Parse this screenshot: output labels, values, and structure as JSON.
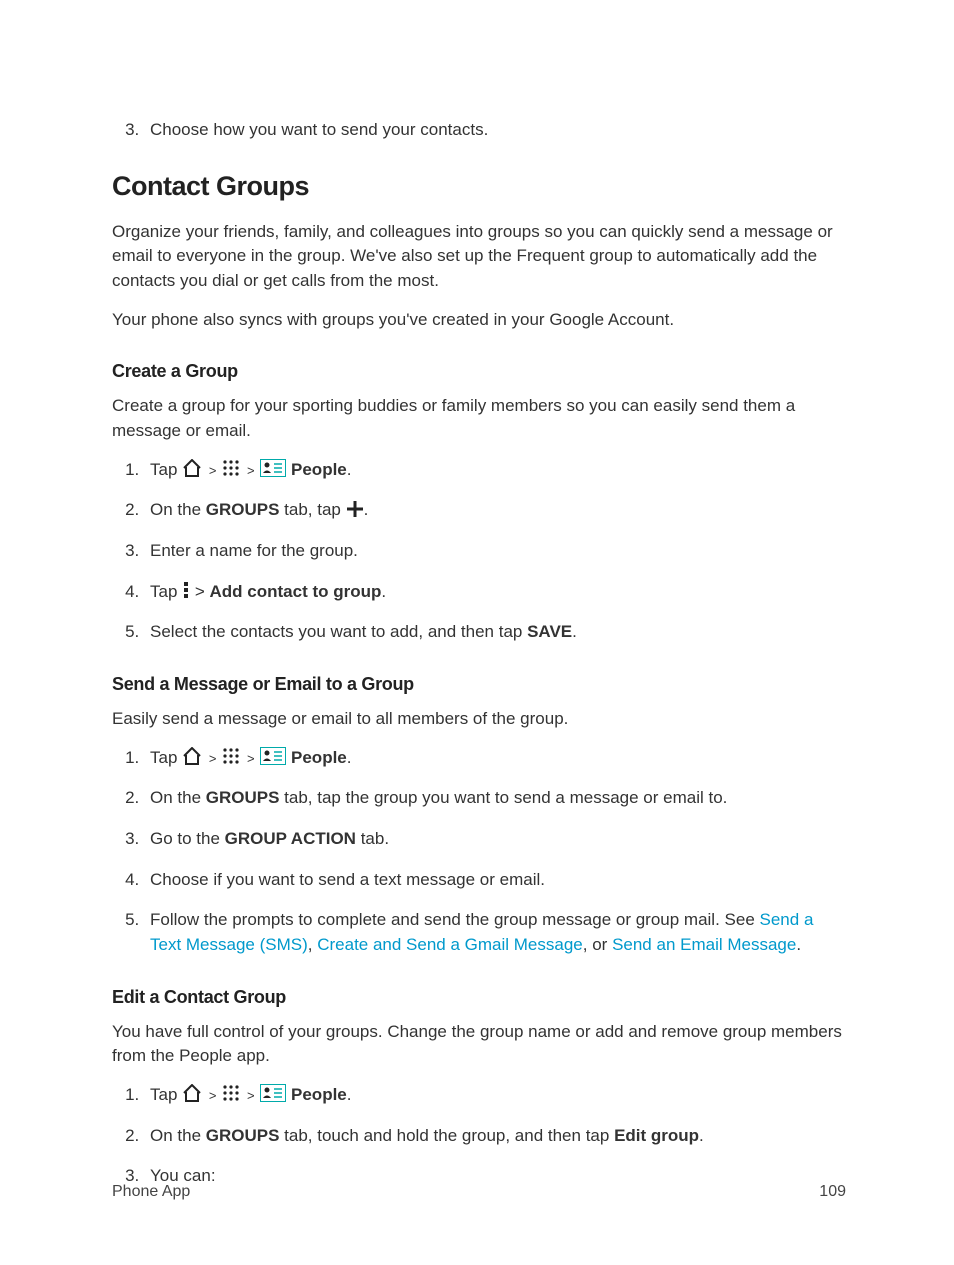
{
  "topList": {
    "start": 3,
    "item1": "Choose how you want to send your contacts."
  },
  "section": {
    "title": "Contact Groups",
    "intro1": "Organize your friends, family, and colleagues into groups so you can quickly send a message or email to everyone in the group. We've also set up the Frequent group to automatically add the contacts you dial or get calls from the most.",
    "intro2": "Your phone also syncs with groups you've created in your Google Account."
  },
  "createGroup": {
    "heading": "Create a Group",
    "intro": "Create a group for your sporting buddies or family members so you can easily send them a message or email.",
    "tap": "Tap",
    "peopleBold": "People",
    "step2a": "On the ",
    "step2b": "GROUPS",
    "step2c": " tab, tap ",
    "step2d": ".",
    "step3": "Enter a name for the group.",
    "step4a": "Tap ",
    "step4b": " > ",
    "step4c": "Add contact to group",
    "step4d": ".",
    "step5a": "Select the contacts you want to add, and then tap ",
    "step5b": "SAVE",
    "step5c": "."
  },
  "sendGroup": {
    "heading": "Send a Message or Email to a Group",
    "intro": "Easily send a message or email to all members of the group.",
    "tap": "Tap",
    "peopleBold": "People",
    "step2a": "On the ",
    "step2b": "GROUPS",
    "step2c": " tab, tap the group you want to send a message or email to.",
    "step3a": "Go to the ",
    "step3b": "GROUP ACTION",
    "step3c": " tab.",
    "step4": "Choose if you want to send a text message or email.",
    "step5a": "Follow the prompts to complete and send the group message or group mail. See ",
    "linkSMS": "Send a Text Message (SMS)",
    "sep1": ", ",
    "linkGmail": "Create and Send a Gmail Message",
    "sep2": ", or ",
    "linkEmail": "Send an Email Message",
    "step5end": "."
  },
  "editGroup": {
    "heading": "Edit a Contact Group",
    "intro": "You have full control of your groups. Change the group name or add and remove group members from the People app.",
    "tap": "Tap",
    "peopleBold": "People",
    "step2a": "On the ",
    "step2b": "GROUPS",
    "step2c": " tab, touch and hold the group, and then tap ",
    "step2d": "Edit group",
    "step2e": ".",
    "step3": "You can:"
  },
  "footer": {
    "left": "Phone App",
    "right": "109"
  }
}
